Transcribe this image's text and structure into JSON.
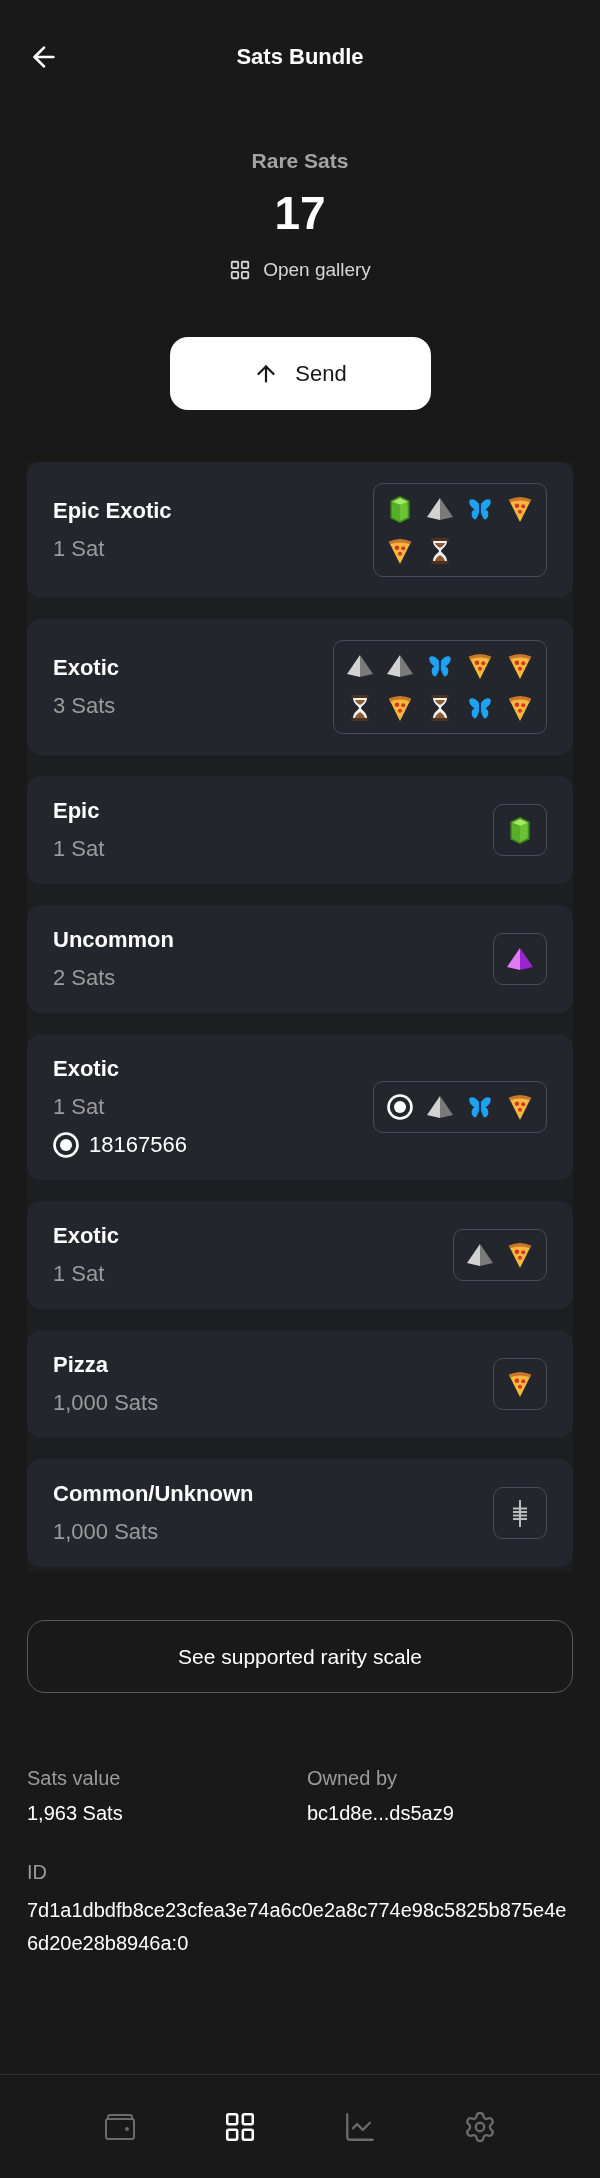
{
  "header": {
    "title": "Sats Bundle"
  },
  "summary": {
    "label": "Rare Sats",
    "count": "17",
    "gallery_link": "Open gallery"
  },
  "send_button": {
    "label": "Send"
  },
  "rarity_list": [
    {
      "title": "Epic Exotic",
      "amount": "1 Sat",
      "satributes": [
        {
          "kind": "gem"
        },
        {
          "kind": "pyramid"
        },
        {
          "kind": "butterfly"
        },
        {
          "kind": "pizza"
        },
        {
          "kind": "pizza"
        },
        {
          "kind": "hourglass"
        }
      ]
    },
    {
      "title": "Exotic",
      "amount": "3 Sats",
      "satributes": [
        {
          "kind": "pyramid"
        },
        {
          "kind": "pyramid"
        },
        {
          "kind": "butterfly"
        },
        {
          "kind": "pizza"
        },
        {
          "kind": "pizza"
        },
        {
          "kind": "hourglass"
        },
        {
          "kind": "pizza"
        },
        {
          "kind": "hourglass"
        },
        {
          "kind": "butterfly"
        },
        {
          "kind": "pizza"
        }
      ]
    },
    {
      "title": "Epic",
      "amount": "1 Sat",
      "satributes": [
        {
          "kind": "gem"
        }
      ]
    },
    {
      "title": "Uncommon",
      "amount": "2 Sats",
      "satributes": [
        {
          "kind": "violetpyramid"
        }
      ]
    },
    {
      "title": "Exotic",
      "amount": "1 Sat",
      "number": "18167566",
      "satributes": [
        {
          "kind": "ring"
        },
        {
          "kind": "pyramid"
        },
        {
          "kind": "butterfly"
        },
        {
          "kind": "pizza"
        }
      ]
    },
    {
      "title": "Exotic",
      "amount": "1 Sat",
      "satributes": [
        {
          "kind": "pyramid"
        },
        {
          "kind": "pizza"
        }
      ]
    },
    {
      "title": "Pizza",
      "amount": "1,000 Sats",
      "satributes": [
        {
          "kind": "pizza"
        }
      ]
    },
    {
      "title": "Common/Unknown",
      "amount": "1,000 Sats",
      "satributes": [
        {
          "kind": "lines"
        }
      ]
    }
  ],
  "rarity_scale_button": {
    "label": "See supported rarity scale"
  },
  "details": [
    {
      "label": "Sats value",
      "value": "1,963 Sats"
    },
    {
      "label": "Owned by",
      "value": "bc1d8e...ds5az9"
    }
  ],
  "id": {
    "label": "ID",
    "value": "7d1a1dbdfb8ce23cfea3e74a6c0e2a8c774e98c5825b875e4e6d20e28b8946a:0"
  },
  "bottom_nav": [
    {
      "kind": "wallet",
      "selected": false
    },
    {
      "kind": "grid",
      "selected": true
    },
    {
      "kind": "chart",
      "selected": false
    },
    {
      "kind": "settings",
      "selected": false
    }
  ]
}
